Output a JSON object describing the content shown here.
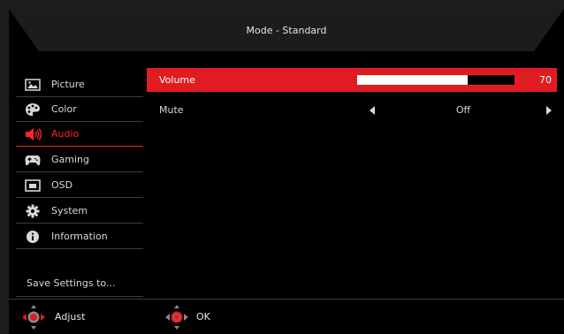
{
  "header": {
    "title": "Mode - Standard"
  },
  "sidebar": {
    "items": [
      {
        "label": "Picture",
        "icon": "picture-icon"
      },
      {
        "label": "Color",
        "icon": "palette-icon"
      },
      {
        "label": "Audio",
        "icon": "speaker-icon"
      },
      {
        "label": "Gaming",
        "icon": "gamepad-icon"
      },
      {
        "label": "OSD",
        "icon": "osd-icon"
      },
      {
        "label": "System",
        "icon": "gear-icon"
      },
      {
        "label": "Information",
        "icon": "info-icon"
      }
    ],
    "active_index": 2,
    "save_label": "Save Settings to..."
  },
  "main": {
    "volume": {
      "label": "Volume",
      "value": "70",
      "level": 0.7
    },
    "mute": {
      "label": "Mute",
      "value": "Off"
    }
  },
  "footer": {
    "adjust_label": "Adjust",
    "ok_label": "OK"
  },
  "colors": {
    "accent": "#e01c22",
    "background": "#000000"
  }
}
